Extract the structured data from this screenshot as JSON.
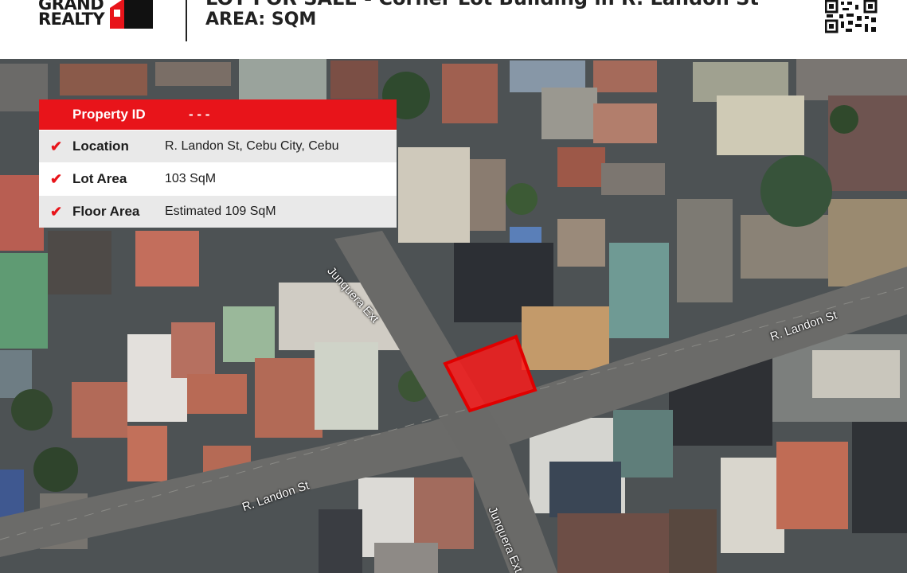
{
  "header": {
    "logo": {
      "line1": "GRAND",
      "line2": "REALTY"
    },
    "title": "LOT FOR SALE - Corner Lot Building in R. Landon St",
    "area_label": "AREA:  SQM"
  },
  "info_card": {
    "property_id_label": "Property ID",
    "property_id_value": "- - -",
    "rows": [
      {
        "label": "Location",
        "value": "R. Landon St, Cebu City, Cebu"
      },
      {
        "label": "Lot Area",
        "value": "103 SqM"
      },
      {
        "label": "Floor Area",
        "value": "Estimated 109 SqM"
      }
    ]
  },
  "map": {
    "streets": [
      {
        "name": "Junquera Ext"
      },
      {
        "name": "R. Landon St"
      },
      {
        "name": "R. Landon St"
      },
      {
        "name": "Junquera Ext"
      }
    ],
    "highlight_color": "#ff1a1a"
  },
  "colors": {
    "accent": "#e8141a",
    "row_alt": "#e9e9e9"
  },
  "icons": {
    "check": "checkmark-icon",
    "qr": "qr-code-icon",
    "logo": "house-logo-icon"
  }
}
